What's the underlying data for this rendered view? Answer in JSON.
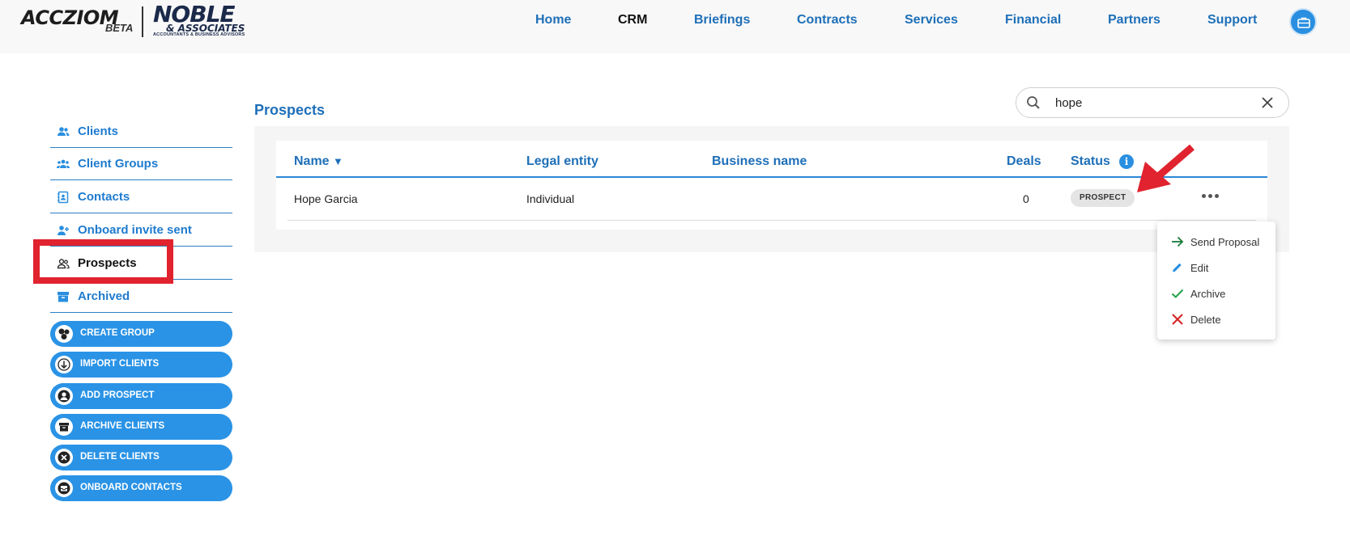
{
  "header": {
    "logo": {
      "brand": "ACCZIOM",
      "beta": "BETA",
      "partner": "NOBLE",
      "partner_sub": "& ASSOCIATES",
      "partner_tag": "ACCOUNTANTS & BUSINESS ADVISORS"
    },
    "nav": [
      {
        "label": "Home",
        "active": false
      },
      {
        "label": "CRM",
        "active": true
      },
      {
        "label": "Briefings",
        "active": false
      },
      {
        "label": "Contracts",
        "active": false
      },
      {
        "label": "Services",
        "active": false
      },
      {
        "label": "Financial",
        "active": false
      },
      {
        "label": "Partners",
        "active": false
      },
      {
        "label": "Support",
        "active": false
      }
    ],
    "profile_icon": "briefcase-icon"
  },
  "sidebar": {
    "items": [
      {
        "label": "Clients",
        "icon": "users-icon"
      },
      {
        "label": "Client Groups",
        "icon": "user-group-icon"
      },
      {
        "label": "Contacts",
        "icon": "contact-book-icon"
      },
      {
        "label": "Onboard invite sent",
        "icon": "user-plus-icon"
      },
      {
        "label": "Prospects",
        "icon": "users-outline-icon",
        "active": true
      },
      {
        "label": "Archived",
        "icon": "archive-box-icon"
      }
    ],
    "actions": [
      {
        "label": "CREATE GROUP",
        "icon": "group-circles-icon"
      },
      {
        "label": "IMPORT CLIENTS",
        "icon": "arrow-down-icon"
      },
      {
        "label": "ADD PROSPECT",
        "icon": "person-icon"
      },
      {
        "label": "ARCHIVE CLIENTS",
        "icon": "archive-icon"
      },
      {
        "label": "DELETE CLIENTS",
        "icon": "x-icon"
      },
      {
        "label": "ONBOARD CONTACTS",
        "icon": "inbox-icon"
      }
    ]
  },
  "main": {
    "title": "Prospects",
    "search": {
      "value": "hope",
      "placeholder": ""
    },
    "table": {
      "columns": [
        "Name",
        "Legal entity",
        "Business name",
        "Deals",
        "Status"
      ],
      "sort_column": "Name",
      "sort_indicator": "▼",
      "rows": [
        {
          "name": "Hope Garcia",
          "legal_entity": "Individual",
          "business_name": "",
          "deals": "0",
          "status": "PROSPECT"
        }
      ]
    },
    "row_menu": [
      {
        "label": "Send Proposal",
        "icon": "arrow-right-icon",
        "color": "#1a7a3a"
      },
      {
        "label": "Edit",
        "icon": "pencil-icon",
        "color": "#2a8fe0"
      },
      {
        "label": "Archive",
        "icon": "check-icon",
        "color": "#22a04a"
      },
      {
        "label": "Delete",
        "icon": "x-icon",
        "color": "#d62828"
      }
    ]
  },
  "colors": {
    "accent": "#1e6fb8",
    "button": "#2a93e6",
    "highlight": "#e0232f"
  }
}
